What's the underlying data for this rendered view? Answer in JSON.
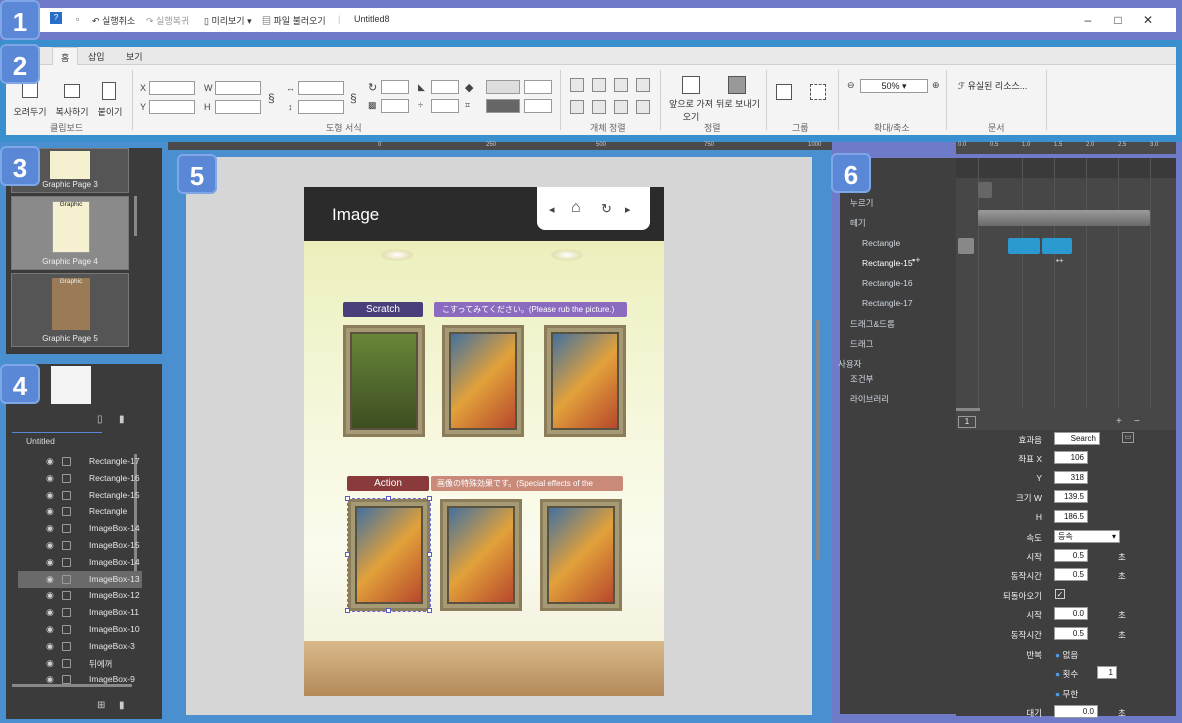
{
  "titlebar": {
    "undo": "실행취소",
    "redo": "실행복귀",
    "preview": "미리보기",
    "load_file": "파일 불러오기",
    "doc_title": "Untitled8"
  },
  "ribbon": {
    "tabs": [
      "홈",
      "삽입",
      "보기"
    ],
    "clipboard": {
      "cut": "오려두기",
      "copy": "복사하기",
      "paste": "붙이기",
      "label": "클립보드"
    },
    "shape_format": {
      "x_label": "X",
      "y_label": "Y",
      "w_label": "W",
      "h_label": "H",
      "label": "도형 서식"
    },
    "object_align": {
      "label": "개체 정렬"
    },
    "arrange": {
      "front": "앞으로 가져오기",
      "back": "뒤로 보내기",
      "label": "정렬"
    },
    "group": {
      "label": "그룹"
    },
    "zoom": {
      "value": "50%",
      "label": "확대/축소"
    },
    "document": {
      "unused_resources": "유실된 리소스...",
      "label": "문서"
    }
  },
  "pages": [
    {
      "label": "Graphic Page 3"
    },
    {
      "label": "Graphic Page 4",
      "tag": "Graphic"
    },
    {
      "label": "Graphic Page 5",
      "tag": "Graphic"
    }
  ],
  "layers": {
    "root": "Untitled",
    "items": [
      "Rectangle-17",
      "Rectangle-16",
      "Rectangle-15",
      "Rectangle",
      "ImageBox-14",
      "ImageBox-15",
      "ImageBox-14",
      "ImageBox-13",
      "ImageBox-12",
      "ImageBox-11",
      "ImageBox-10",
      "ImageBox-3",
      "뒤에꺼",
      "ImageBox-9"
    ],
    "selected_index": 7
  },
  "canvas": {
    "header_title": "Image",
    "scratch_label": "Scratch",
    "scratch_note": "こすってみてください。(Please rub the picture.)",
    "action_label": "Action",
    "action_note": "画像の特殊効果です。(Special effects of the picture.)"
  },
  "ruler_top": [
    "0",
    "250",
    "500",
    "750",
    "1000"
  ],
  "events": {
    "items": [
      "누르기",
      "떼기",
      "Rectangle",
      "Rectangle-15",
      "Rectangle-16",
      "Rectangle-17",
      "드래그&드롭",
      "드래그",
      "사용자",
      "조건부",
      "라이브러리"
    ]
  },
  "timeline": {
    "ruler": [
      "0.0",
      "0.5",
      "1.0",
      "1.5",
      "2.0",
      "2.5",
      "3.0"
    ],
    "page": "1"
  },
  "properties": {
    "sound_label": "효과음",
    "sound_value": "Search",
    "x_label": "좌표 X",
    "x_value": "106",
    "y_label": "Y",
    "y_value": "318",
    "w_label": "크기 W",
    "w_value": "139.5",
    "h_label": "H",
    "h_value": "186.5",
    "speed_label": "속도",
    "speed_value": "등속",
    "start_label": "시작",
    "start_value": "0.5",
    "duration_label": "동작시간",
    "duration_value": "0.5",
    "return_label": "되돌아오기",
    "return_start_label": "시작",
    "return_start_value": "0.0",
    "return_duration_label": "동작시간",
    "return_duration_value": "0.5",
    "repeat_label": "반복",
    "repeat_none": "없음",
    "repeat_count_label": "횟수",
    "repeat_count_value": "1",
    "repeat_infinite": "무한",
    "wait_label": "대기",
    "wait_value": "0.0",
    "sec": "초"
  },
  "region_numbers": [
    "1",
    "2",
    "3",
    "4",
    "5",
    "6"
  ],
  "colors": {
    "frame_blue": "#3a8fcf",
    "badge_blue": "#5b88d6",
    "scratch_badge": "#4a3f7a",
    "scratch_note_bg": "#8a6bbf",
    "action_badge": "#8a3a3a",
    "action_note_bg": "#c98a7a",
    "timeline_bar": "#2a9ad0"
  }
}
